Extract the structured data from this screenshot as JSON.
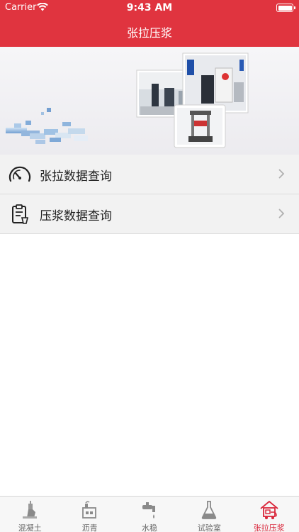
{
  "status_bar": {
    "carrier": "Carrier",
    "time": "9:43 AM"
  },
  "nav": {
    "title": "张拉压浆"
  },
  "menu": [
    {
      "label": "张拉数据查询",
      "icon": "gauge-icon"
    },
    {
      "label": "压浆数据查询",
      "icon": "clipboard-icon"
    }
  ],
  "tabs": [
    {
      "label": "混凝土",
      "icon": "concrete-plant-icon",
      "active": false
    },
    {
      "label": "沥青",
      "icon": "asphalt-factory-icon",
      "active": false
    },
    {
      "label": "水稳",
      "icon": "water-tap-icon",
      "active": false
    },
    {
      "label": "试验室",
      "icon": "flask-icon",
      "active": false
    },
    {
      "label": "张拉压浆",
      "icon": "tension-truck-icon",
      "active": true
    }
  ],
  "colors": {
    "brand": "#e0343f",
    "active_tab": "#d9263a",
    "inactive_tab": "#666666"
  }
}
